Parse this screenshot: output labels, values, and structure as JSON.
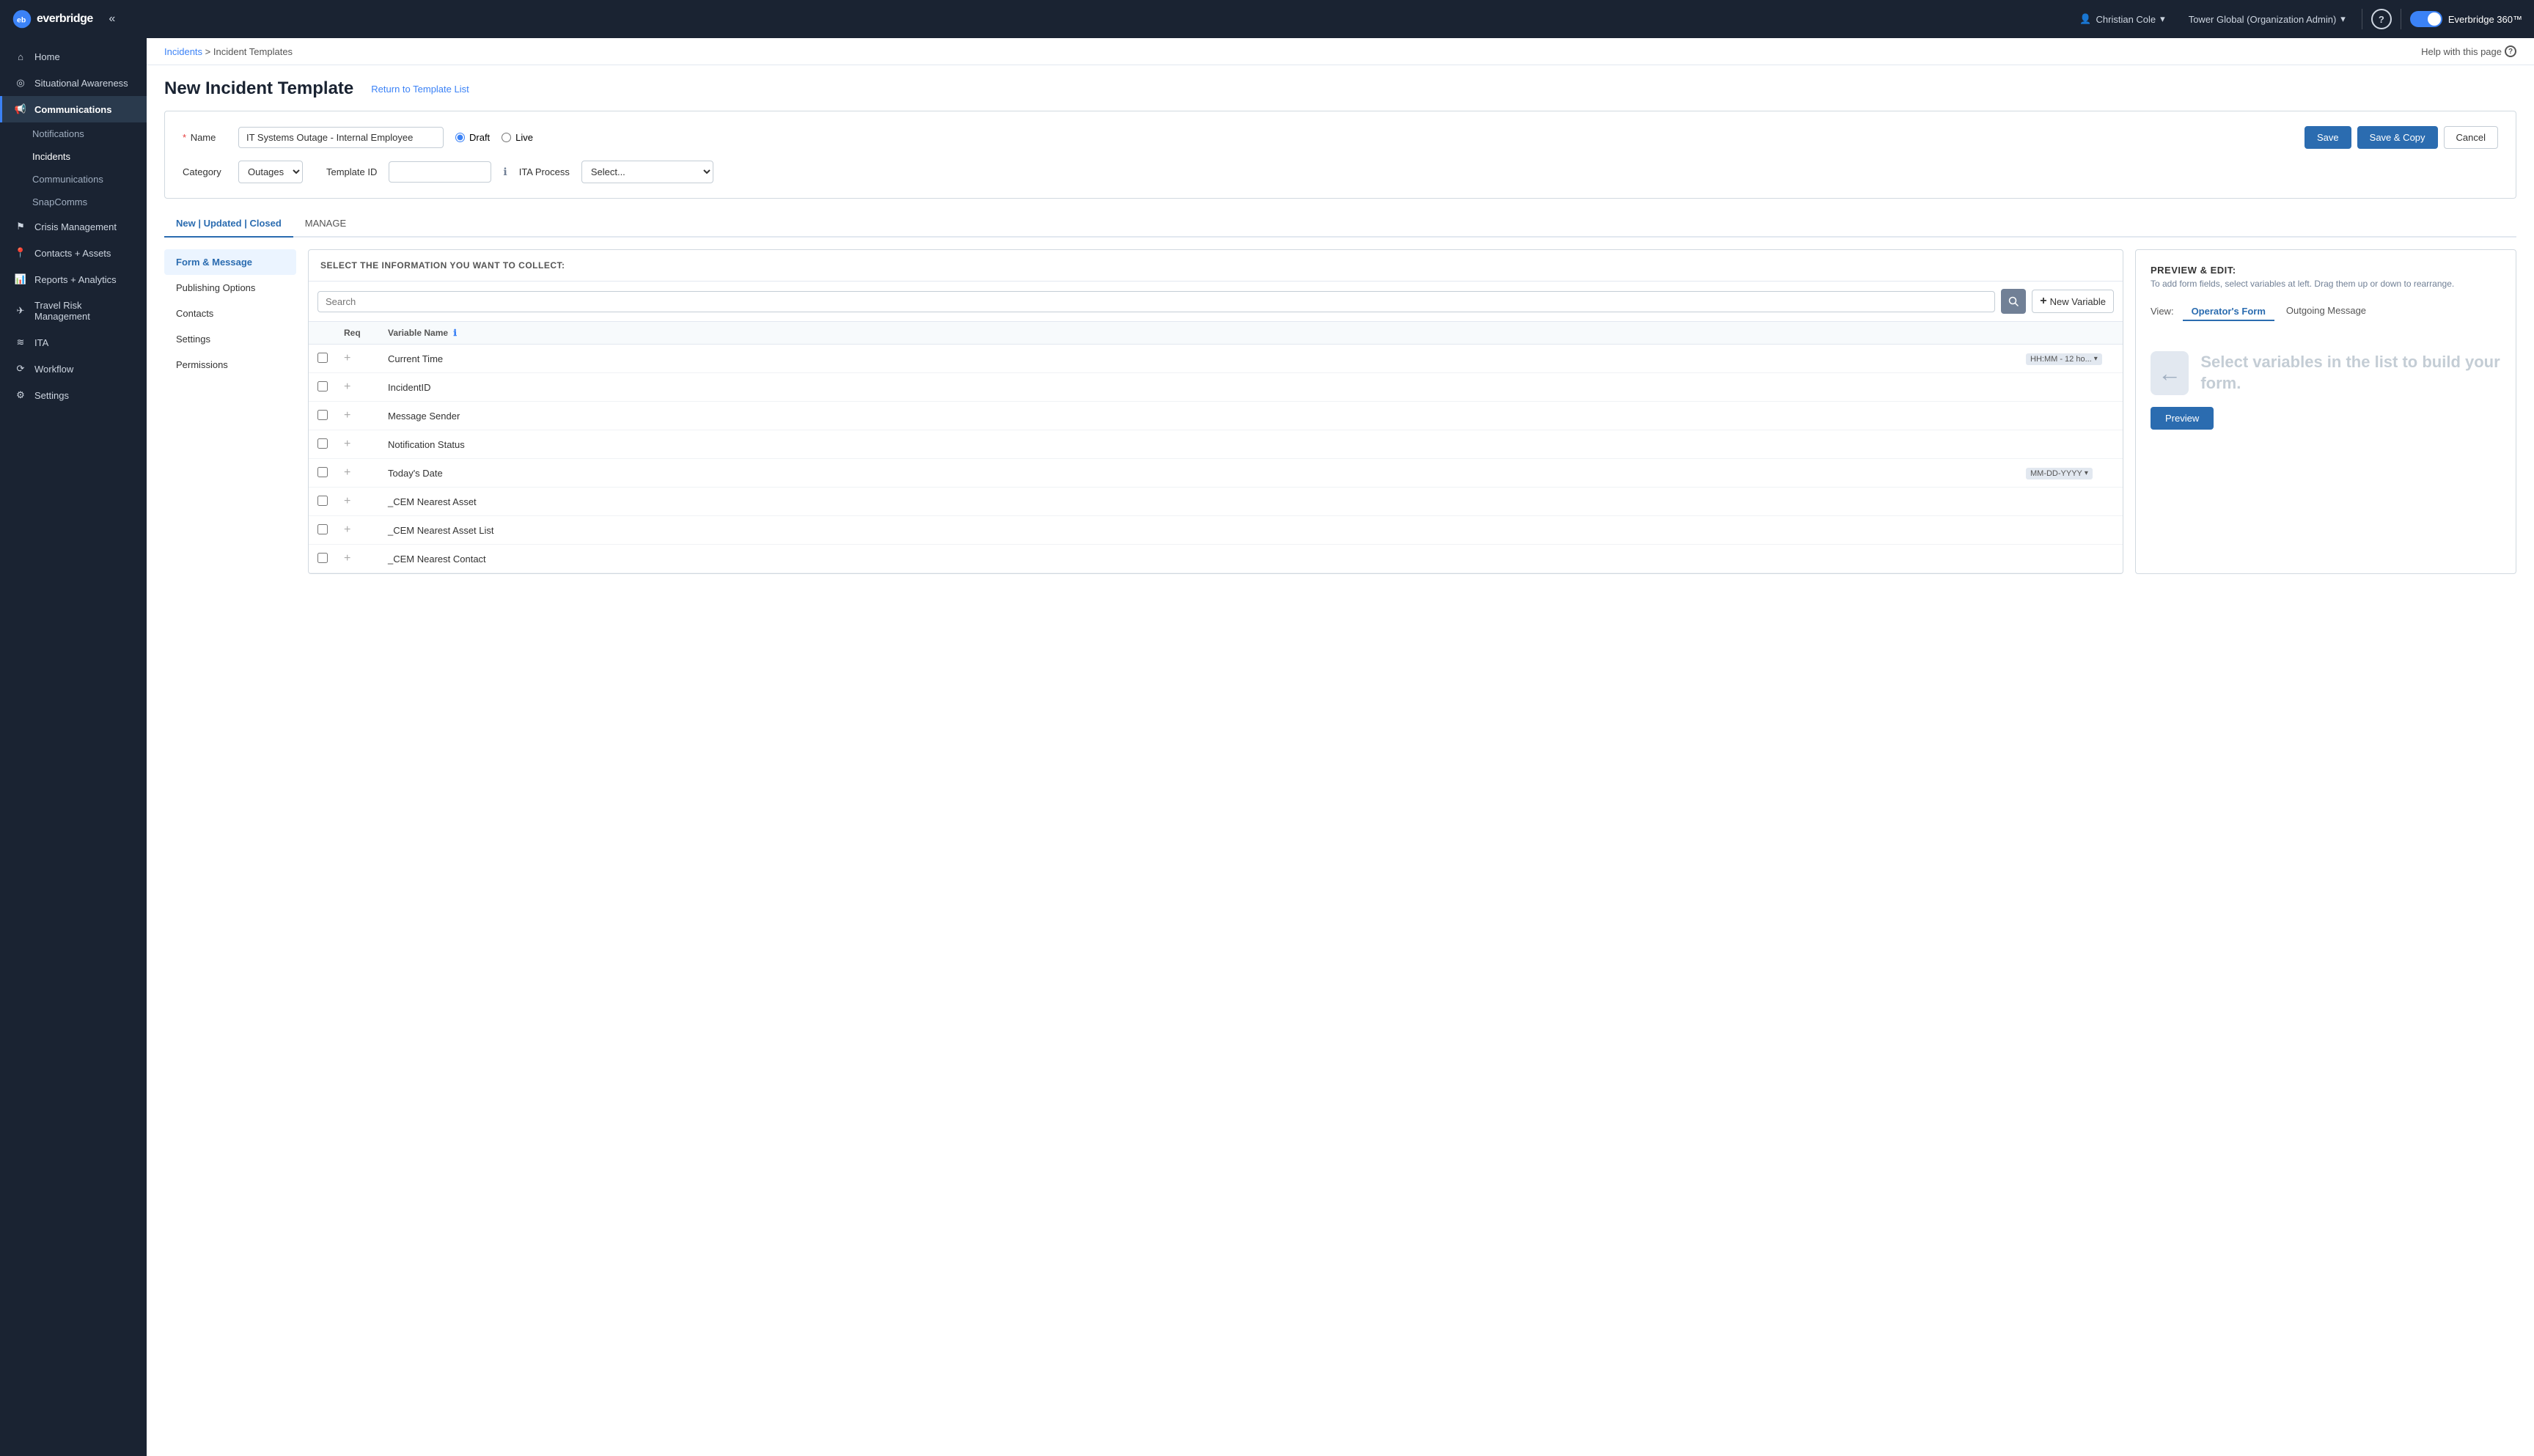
{
  "topnav": {
    "logo_text": "everbridge",
    "collapse_icon": "«",
    "user_name": "Christian Cole",
    "user_chevron": "▾",
    "org_name": "Tower Global (Organization Admin)",
    "org_chevron": "▾",
    "help_icon": "?",
    "toggle_label": "Everbridge 360™"
  },
  "sidebar": {
    "items": [
      {
        "id": "home",
        "icon": "⌂",
        "label": "Home"
      },
      {
        "id": "situational-awareness",
        "icon": "◎",
        "label": "Situational Awareness"
      },
      {
        "id": "communications",
        "icon": "📢",
        "label": "Communications",
        "active": true
      },
      {
        "id": "notifications",
        "icon": "",
        "label": "Notifications",
        "sub": true
      },
      {
        "id": "incidents",
        "icon": "",
        "label": "Incidents",
        "sub": true,
        "active_sub": true
      },
      {
        "id": "communications-sub",
        "icon": "",
        "label": "Communications",
        "sub": true
      },
      {
        "id": "snapcomms",
        "icon": "",
        "label": "SnapComms",
        "sub": true
      },
      {
        "id": "crisis-management",
        "icon": "⚑",
        "label": "Crisis Management"
      },
      {
        "id": "contacts-assets",
        "icon": "📍",
        "label": "Contacts + Assets"
      },
      {
        "id": "reports-analytics",
        "icon": "📊",
        "label": "Reports + Analytics"
      },
      {
        "id": "travel-risk-management",
        "icon": "✈",
        "label": "Travel Risk Management"
      },
      {
        "id": "ita",
        "icon": "≋",
        "label": "ITA"
      },
      {
        "id": "workflow",
        "icon": "⟳",
        "label": "Workflow"
      },
      {
        "id": "settings",
        "icon": "⚙",
        "label": "Settings"
      }
    ]
  },
  "breadcrumb": {
    "parent": "Incidents",
    "separator": ">",
    "current": "Incident Templates"
  },
  "help_link": "Help with this page",
  "page": {
    "title": "New Incident Template",
    "return_link": "Return to Template List"
  },
  "form": {
    "name_label": "Name",
    "name_value": "IT Systems Outage - Internal Employee",
    "name_placeholder": "",
    "draft_label": "Draft",
    "live_label": "Live",
    "category_label": "Category",
    "category_value": "Outages",
    "template_id_label": "Template ID",
    "template_id_value": "",
    "ita_process_label": "ITA Process",
    "ita_process_placeholder": "Select...",
    "save_label": "Save",
    "save_copy_label": "Save & Copy",
    "cancel_label": "Cancel"
  },
  "tabs": [
    {
      "id": "new-updated-closed",
      "label": "New | Updated | Closed",
      "active": true
    },
    {
      "id": "manage",
      "label": "MANAGE"
    }
  ],
  "left_nav": [
    {
      "id": "form-message",
      "label": "Form & Message",
      "active": true
    },
    {
      "id": "publishing-options",
      "label": "Publishing Options"
    },
    {
      "id": "contacts",
      "label": "Contacts"
    },
    {
      "id": "settings",
      "label": "Settings"
    },
    {
      "id": "permissions",
      "label": "Permissions"
    }
  ],
  "variables": {
    "section_title": "SELECT THE INFORMATION YOU WANT TO COLLECT:",
    "search_placeholder": "Search",
    "new_variable_label": "New Variable",
    "columns": {
      "req": "Req",
      "variable_name": "Variable Name",
      "info_icon": "ℹ"
    },
    "rows": [
      {
        "id": "current-time",
        "name": "Current Time",
        "badge": "HH:MM - 12 ho...",
        "has_chevron": true
      },
      {
        "id": "incident-id",
        "name": "IncidentID",
        "badge": "",
        "has_chevron": false
      },
      {
        "id": "message-sender",
        "name": "Message Sender",
        "badge": "",
        "has_chevron": false
      },
      {
        "id": "notification-status",
        "name": "Notification Status",
        "badge": "",
        "has_chevron": false
      },
      {
        "id": "todays-date",
        "name": "Today's Date",
        "badge": "MM-DD-YYYY",
        "has_chevron": true
      },
      {
        "id": "cem-nearest-asset",
        "name": "_CEM Nearest Asset",
        "badge": "",
        "has_chevron": false
      },
      {
        "id": "cem-nearest-asset-list",
        "name": "_CEM Nearest Asset List",
        "badge": "",
        "has_chevron": false
      },
      {
        "id": "cem-nearest-contact",
        "name": "_CEM Nearest Contact",
        "badge": "",
        "has_chevron": false
      }
    ]
  },
  "preview": {
    "title": "PREVIEW & EDIT:",
    "subtitle": "To add form fields, select variables at left. Drag them up or down to rearrange.",
    "view_label": "View:",
    "view_tabs": [
      {
        "id": "operators-form",
        "label": "Operator's Form",
        "active": true
      },
      {
        "id": "outgoing-message",
        "label": "Outgoing Message"
      }
    ],
    "empty_text": "Select variables in the list to build your form.",
    "arrow_icon": "←",
    "preview_btn_label": "Preview"
  }
}
